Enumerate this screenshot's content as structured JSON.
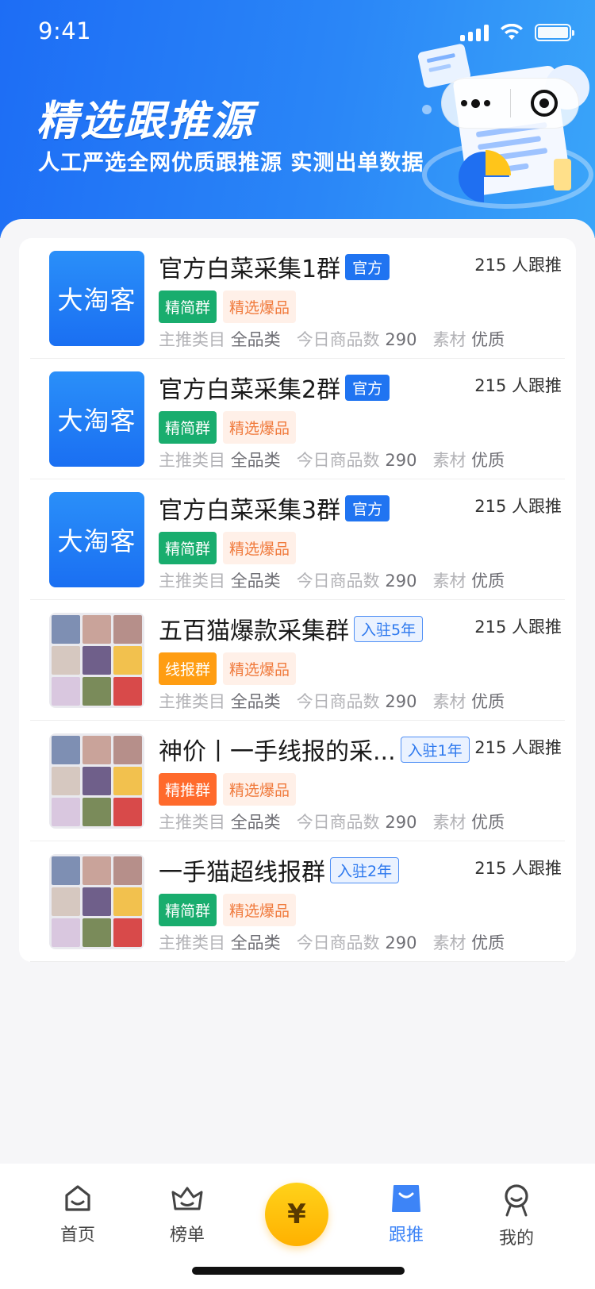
{
  "status": {
    "time": "9:41"
  },
  "hero": {
    "title": "精选跟推源",
    "subtitle": "人工严选全网优质跟推源  实测出单数据"
  },
  "groups": [
    {
      "name": "官方白菜采集1群",
      "badge": "官方",
      "badge_type": "official",
      "thumb": "brand",
      "thumb_text": "大淘客",
      "tags": [
        {
          "label": "精简群",
          "style": "green"
        },
        {
          "label": "精选爆品",
          "style": "light"
        }
      ],
      "followers": "215 人跟推",
      "meta": {
        "category_key": "主推类目",
        "category_value": "全品类",
        "count_key": "今日商品数",
        "count_value": "290",
        "material_key": "素材",
        "material_value": "优质"
      }
    },
    {
      "name": "官方白菜采集2群",
      "badge": "官方",
      "badge_type": "official",
      "thumb": "brand",
      "thumb_text": "大淘客",
      "tags": [
        {
          "label": "精简群",
          "style": "green"
        },
        {
          "label": "精选爆品",
          "style": "light"
        }
      ],
      "followers": "215 人跟推",
      "meta": {
        "category_key": "主推类目",
        "category_value": "全品类",
        "count_key": "今日商品数",
        "count_value": "290",
        "material_key": "素材",
        "material_value": "优质"
      }
    },
    {
      "name": "官方白菜采集3群",
      "badge": "官方",
      "badge_type": "official",
      "thumb": "brand",
      "thumb_text": "大淘客",
      "tags": [
        {
          "label": "精简群",
          "style": "green"
        },
        {
          "label": "精选爆品",
          "style": "light"
        }
      ],
      "followers": "215 人跟推",
      "meta": {
        "category_key": "主推类目",
        "category_value": "全品类",
        "count_key": "今日商品数",
        "count_value": "290",
        "material_key": "素材",
        "material_value": "优质"
      }
    },
    {
      "name": "五百猫爆款采集群",
      "badge": "入驻5年",
      "badge_type": "year",
      "thumb": "grid",
      "thumb_text": "",
      "tags": [
        {
          "label": "线报群",
          "style": "orange"
        },
        {
          "label": "精选爆品",
          "style": "light"
        }
      ],
      "followers": "215 人跟推",
      "meta": {
        "category_key": "主推类目",
        "category_value": "全品类",
        "count_key": "今日商品数",
        "count_value": "290",
        "material_key": "素材",
        "material_value": "优质"
      }
    },
    {
      "name": "神价丨一手线报的采...",
      "badge": "入驻1年",
      "badge_type": "year",
      "thumb": "grid",
      "thumb_text": "",
      "tags": [
        {
          "label": "精推群",
          "style": "redorange"
        },
        {
          "label": "精选爆品",
          "style": "light"
        }
      ],
      "followers": "215 人跟推",
      "meta": {
        "category_key": "主推类目",
        "category_value": "全品类",
        "count_key": "今日商品数",
        "count_value": "290",
        "material_key": "素材",
        "material_value": "优质"
      }
    },
    {
      "name": "一手猫超线报群",
      "badge": "入驻2年",
      "badge_type": "year",
      "thumb": "grid",
      "thumb_text": "",
      "tags": [
        {
          "label": "精简群",
          "style": "green"
        },
        {
          "label": "精选爆品",
          "style": "light"
        }
      ],
      "followers": "215 人跟推",
      "meta": {
        "category_key": "主推类目",
        "category_value": "全品类",
        "count_key": "今日商品数",
        "count_value": "290",
        "material_key": "素材",
        "material_value": "优质"
      }
    }
  ],
  "tabbar": {
    "home": "首页",
    "rank": "榜单",
    "center_symbol": "¥",
    "follow": "跟推",
    "mine": "我的",
    "active": "follow",
    "accent": "#3d84f7"
  },
  "colors": {
    "primary": "#2074f1",
    "brand_green": "#19ad6e",
    "brand_orange": "#ff9d12",
    "brand_redorange": "#ff6a2c",
    "coin": "#ffc107"
  }
}
